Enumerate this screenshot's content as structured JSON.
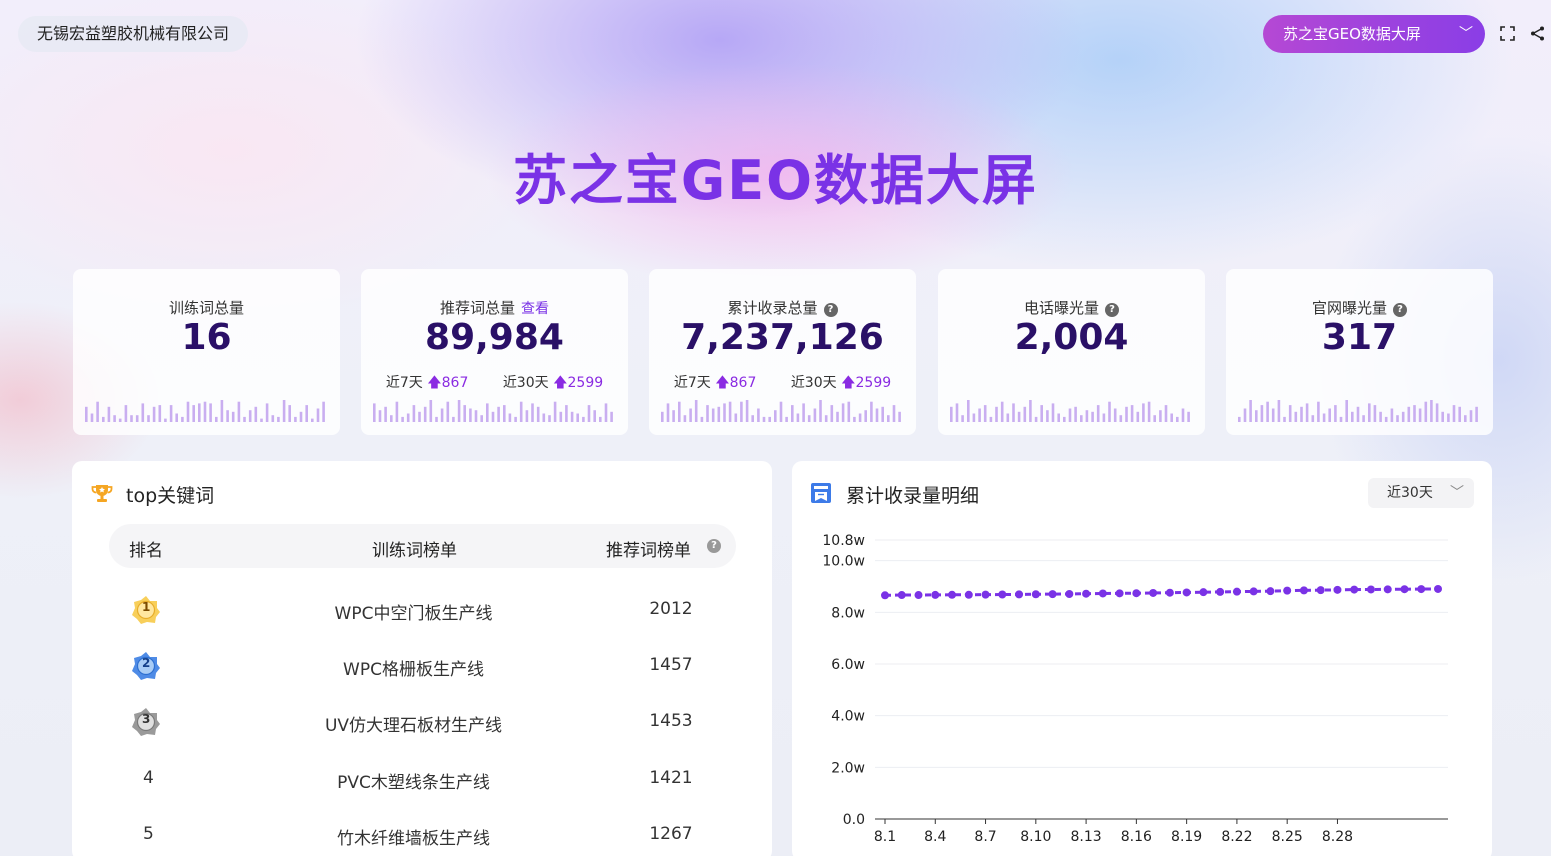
{
  "header": {
    "company": "无锡宏益塑胶机械有限公司",
    "screen_select": "苏之宝GEO数据大屏",
    "title": "苏之宝GEO数据大屏"
  },
  "stats": [
    {
      "label": "训练词总量",
      "value": "16",
      "spark": [
        9,
        5,
        12,
        3,
        9,
        4,
        2,
        10,
        4,
        4,
        11,
        4,
        9,
        10,
        2,
        10,
        5,
        3,
        12,
        10,
        11,
        12,
        11,
        3,
        13,
        7,
        6,
        12,
        3,
        7,
        9,
        2,
        11,
        4,
        3,
        13,
        10,
        3,
        6,
        10,
        2,
        8,
        12
      ]
    },
    {
      "label": "推荐词总量",
      "link": "查看",
      "value": "89,984",
      "trend": {
        "d7_label": "近7天",
        "d7": "867",
        "d30_label": "近30天",
        "d30": "2599"
      },
      "spark": [
        11,
        7,
        9,
        4,
        12,
        3,
        5,
        10,
        6,
        9,
        13,
        3,
        8,
        12,
        3,
        13,
        10,
        8,
        7,
        4,
        11,
        6,
        9,
        10,
        5,
        3,
        12,
        7,
        11,
        9,
        5,
        4,
        12,
        6,
        10,
        6,
        5,
        3,
        10,
        7,
        3,
        11,
        6
      ]
    },
    {
      "label": "累计收录总量",
      "help": "?",
      "value": "7,237,126",
      "trend": {
        "d7_label": "近7天",
        "d7": "867",
        "d30_label": "近30天",
        "d30": "2599"
      },
      "spark": [
        6,
        11,
        7,
        12,
        4,
        8,
        13,
        3,
        10,
        8,
        9,
        11,
        12,
        5,
        12,
        13,
        4,
        8,
        3,
        3,
        7,
        12,
        3,
        10,
        5,
        11,
        4,
        8,
        13,
        4,
        10,
        6,
        11,
        12,
        3,
        5,
        7,
        12,
        8,
        9,
        4,
        10,
        6
      ]
    },
    {
      "label": "电话曝光量",
      "help": "?",
      "value": "2,004",
      "spark": [
        9,
        11,
        4,
        13,
        5,
        8,
        10,
        3,
        9,
        12,
        5,
        11,
        6,
        9,
        13,
        3,
        10,
        7,
        11,
        5,
        3,
        8,
        9,
        4,
        7,
        6,
        10,
        5,
        12,
        8,
        4,
        9,
        10,
        6,
        11,
        12,
        4,
        7,
        10,
        5,
        3,
        8,
        6
      ]
    },
    {
      "label": "官网曝光量",
      "help": "?",
      "value": "317",
      "spark": [
        3,
        8,
        13,
        7,
        10,
        12,
        8,
        13,
        3,
        10,
        6,
        9,
        11,
        4,
        12,
        5,
        8,
        10,
        3,
        13,
        6,
        9,
        4,
        11,
        10,
        6,
        3,
        8,
        4,
        6,
        9,
        10,
        8,
        12,
        13,
        11,
        6,
        5,
        10,
        9,
        4,
        7,
        9
      ]
    }
  ],
  "top_keywords": {
    "title": "top关键词",
    "columns": [
      "排名",
      "训练词榜单",
      "推荐词榜单"
    ],
    "help": "?",
    "rows": [
      {
        "rank": "1",
        "keyword": "WPC中空门板生产线",
        "count": "2012"
      },
      {
        "rank": "2",
        "keyword": "WPC格栅板生产线",
        "count": "1457"
      },
      {
        "rank": "3",
        "keyword": "UV仿大理石板材生产线",
        "count": "1453"
      },
      {
        "rank": "4",
        "keyword": "PVC木塑线条生产线",
        "count": "1421"
      },
      {
        "rank": "5",
        "keyword": "竹木纤维墙板生产线",
        "count": "1267"
      }
    ]
  },
  "collection_panel": {
    "title": "累计收录量明细",
    "period": "近30天"
  },
  "colors": {
    "accent": "#7a32e6",
    "value": "#2a1067",
    "spark": "#c9aef0"
  },
  "chart_data": {
    "type": "line",
    "title": "累计收录量明细",
    "xlabel": "",
    "ylabel": "",
    "ylim": [
      0,
      108000
    ],
    "y_tick_labels": [
      "0.0",
      "2.0w",
      "4.0w",
      "6.0w",
      "8.0w",
      "10.0w",
      "10.8w"
    ],
    "y_ticks": [
      0,
      20000,
      40000,
      60000,
      80000,
      100000,
      108000
    ],
    "x_tick_labels": [
      "8.1",
      "8.4",
      "8.7",
      "8.10",
      "8.13",
      "8.16",
      "8.19",
      "8.22",
      "8.25",
      "8.28"
    ],
    "x_tick_index": [
      0,
      3,
      6,
      9,
      12,
      15,
      18,
      21,
      24,
      27
    ],
    "series": [
      {
        "values": [
          86600,
          86700,
          86700,
          86750,
          86800,
          86800,
          86850,
          86900,
          86950,
          87000,
          87050,
          87100,
          87200,
          87300,
          87350,
          87400,
          87500,
          87600,
          87700,
          87800,
          87900,
          88000,
          88100,
          88200,
          88400,
          88500,
          88600,
          88700,
          88800,
          88850,
          88900,
          88950,
          89000,
          89050
        ],
        "color": "#7a32e6",
        "style": "dashed-with-markers"
      }
    ],
    "grid": true
  }
}
